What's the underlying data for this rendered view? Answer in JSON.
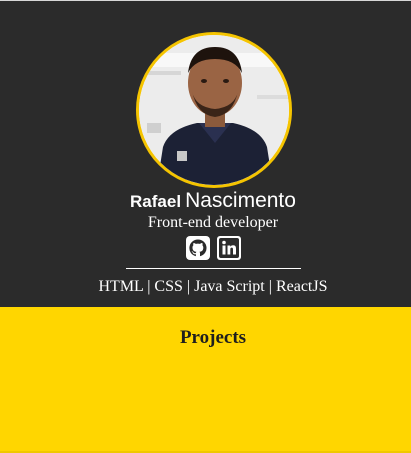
{
  "header": {
    "first_name": "Rafael",
    "last_name": "Nascimento",
    "role": "Front-end developer"
  },
  "social": [
    {
      "icon": "github-icon"
    },
    {
      "icon": "linkedin-icon"
    }
  ],
  "skills": {
    "items": [
      "HTML",
      "CSS",
      "Java Script",
      "ReactJS"
    ],
    "separator": "|"
  },
  "projects": {
    "title": "Projects"
  },
  "colors": {
    "background": "#2b2b2b",
    "accent": "#ffd600",
    "avatar_border": "#f5c400",
    "text": "#ffffff"
  }
}
